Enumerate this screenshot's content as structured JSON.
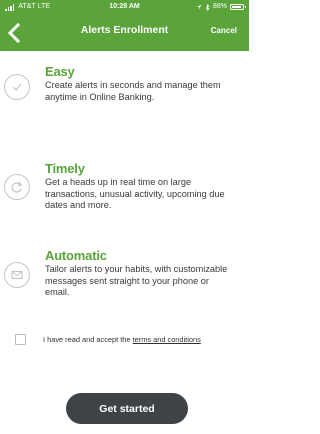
{
  "status_bar": {
    "carrier": "AT&T",
    "network": "LTE",
    "time": "10:28 AM",
    "battery": "88%"
  },
  "nav": {
    "title": "Alerts Enrollment",
    "cancel_label": "Cancel"
  },
  "features": [
    {
      "title": "Easy",
      "description": "Create alerts in seconds and manage them anytime in Online Banking.",
      "icon": "check-circle-icon"
    },
    {
      "title": "Timely",
      "description": "Get a heads up in real time on large transactions, unusual activity, upcoming due dates and more.",
      "icon": "refresh-circle-icon"
    },
    {
      "title": "Automatic",
      "description": "Tailor alerts to your habits, with customizable messages sent straight to your phone or email.",
      "icon": "envelope-circle-icon"
    }
  ],
  "accept": {
    "text": "I have read and accept the ",
    "link": "terms and conditions",
    "checked": false
  },
  "cta_label": "Get started",
  "colors": {
    "brand_green": "#5aa43a",
    "button_dark": "#3f4346"
  }
}
